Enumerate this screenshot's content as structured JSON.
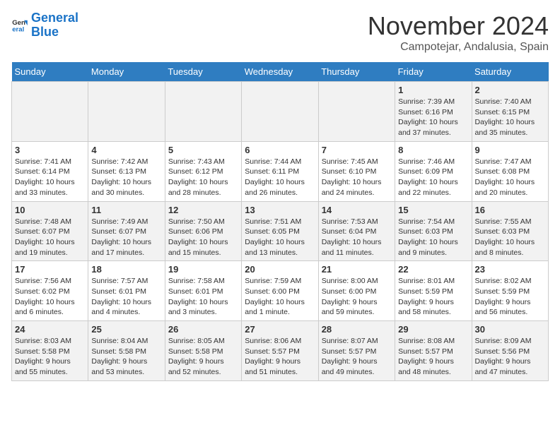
{
  "logo": {
    "line1": "General",
    "line2": "Blue"
  },
  "title": "November 2024",
  "location": "Campotejar, Andalusia, Spain",
  "weekdays": [
    "Sunday",
    "Monday",
    "Tuesday",
    "Wednesday",
    "Thursday",
    "Friday",
    "Saturday"
  ],
  "weeks": [
    [
      {
        "day": "",
        "info": ""
      },
      {
        "day": "",
        "info": ""
      },
      {
        "day": "",
        "info": ""
      },
      {
        "day": "",
        "info": ""
      },
      {
        "day": "",
        "info": ""
      },
      {
        "day": "1",
        "info": "Sunrise: 7:39 AM\nSunset: 6:16 PM\nDaylight: 10 hours\nand 37 minutes."
      },
      {
        "day": "2",
        "info": "Sunrise: 7:40 AM\nSunset: 6:15 PM\nDaylight: 10 hours\nand 35 minutes."
      }
    ],
    [
      {
        "day": "3",
        "info": "Sunrise: 7:41 AM\nSunset: 6:14 PM\nDaylight: 10 hours\nand 33 minutes."
      },
      {
        "day": "4",
        "info": "Sunrise: 7:42 AM\nSunset: 6:13 PM\nDaylight: 10 hours\nand 30 minutes."
      },
      {
        "day": "5",
        "info": "Sunrise: 7:43 AM\nSunset: 6:12 PM\nDaylight: 10 hours\nand 28 minutes."
      },
      {
        "day": "6",
        "info": "Sunrise: 7:44 AM\nSunset: 6:11 PM\nDaylight: 10 hours\nand 26 minutes."
      },
      {
        "day": "7",
        "info": "Sunrise: 7:45 AM\nSunset: 6:10 PM\nDaylight: 10 hours\nand 24 minutes."
      },
      {
        "day": "8",
        "info": "Sunrise: 7:46 AM\nSunset: 6:09 PM\nDaylight: 10 hours\nand 22 minutes."
      },
      {
        "day": "9",
        "info": "Sunrise: 7:47 AM\nSunset: 6:08 PM\nDaylight: 10 hours\nand 20 minutes."
      }
    ],
    [
      {
        "day": "10",
        "info": "Sunrise: 7:48 AM\nSunset: 6:07 PM\nDaylight: 10 hours\nand 19 minutes."
      },
      {
        "day": "11",
        "info": "Sunrise: 7:49 AM\nSunset: 6:07 PM\nDaylight: 10 hours\nand 17 minutes."
      },
      {
        "day": "12",
        "info": "Sunrise: 7:50 AM\nSunset: 6:06 PM\nDaylight: 10 hours\nand 15 minutes."
      },
      {
        "day": "13",
        "info": "Sunrise: 7:51 AM\nSunset: 6:05 PM\nDaylight: 10 hours\nand 13 minutes."
      },
      {
        "day": "14",
        "info": "Sunrise: 7:53 AM\nSunset: 6:04 PM\nDaylight: 10 hours\nand 11 minutes."
      },
      {
        "day": "15",
        "info": "Sunrise: 7:54 AM\nSunset: 6:03 PM\nDaylight: 10 hours\nand 9 minutes."
      },
      {
        "day": "16",
        "info": "Sunrise: 7:55 AM\nSunset: 6:03 PM\nDaylight: 10 hours\nand 8 minutes."
      }
    ],
    [
      {
        "day": "17",
        "info": "Sunrise: 7:56 AM\nSunset: 6:02 PM\nDaylight: 10 hours\nand 6 minutes."
      },
      {
        "day": "18",
        "info": "Sunrise: 7:57 AM\nSunset: 6:01 PM\nDaylight: 10 hours\nand 4 minutes."
      },
      {
        "day": "19",
        "info": "Sunrise: 7:58 AM\nSunset: 6:01 PM\nDaylight: 10 hours\nand 3 minutes."
      },
      {
        "day": "20",
        "info": "Sunrise: 7:59 AM\nSunset: 6:00 PM\nDaylight: 10 hours\nand 1 minute."
      },
      {
        "day": "21",
        "info": "Sunrise: 8:00 AM\nSunset: 6:00 PM\nDaylight: 9 hours\nand 59 minutes."
      },
      {
        "day": "22",
        "info": "Sunrise: 8:01 AM\nSunset: 5:59 PM\nDaylight: 9 hours\nand 58 minutes."
      },
      {
        "day": "23",
        "info": "Sunrise: 8:02 AM\nSunset: 5:59 PM\nDaylight: 9 hours\nand 56 minutes."
      }
    ],
    [
      {
        "day": "24",
        "info": "Sunrise: 8:03 AM\nSunset: 5:58 PM\nDaylight: 9 hours\nand 55 minutes."
      },
      {
        "day": "25",
        "info": "Sunrise: 8:04 AM\nSunset: 5:58 PM\nDaylight: 9 hours\nand 53 minutes."
      },
      {
        "day": "26",
        "info": "Sunrise: 8:05 AM\nSunset: 5:58 PM\nDaylight: 9 hours\nand 52 minutes."
      },
      {
        "day": "27",
        "info": "Sunrise: 8:06 AM\nSunset: 5:57 PM\nDaylight: 9 hours\nand 51 minutes."
      },
      {
        "day": "28",
        "info": "Sunrise: 8:07 AM\nSunset: 5:57 PM\nDaylight: 9 hours\nand 49 minutes."
      },
      {
        "day": "29",
        "info": "Sunrise: 8:08 AM\nSunset: 5:57 PM\nDaylight: 9 hours\nand 48 minutes."
      },
      {
        "day": "30",
        "info": "Sunrise: 8:09 AM\nSunset: 5:56 PM\nDaylight: 9 hours\nand 47 minutes."
      }
    ]
  ]
}
